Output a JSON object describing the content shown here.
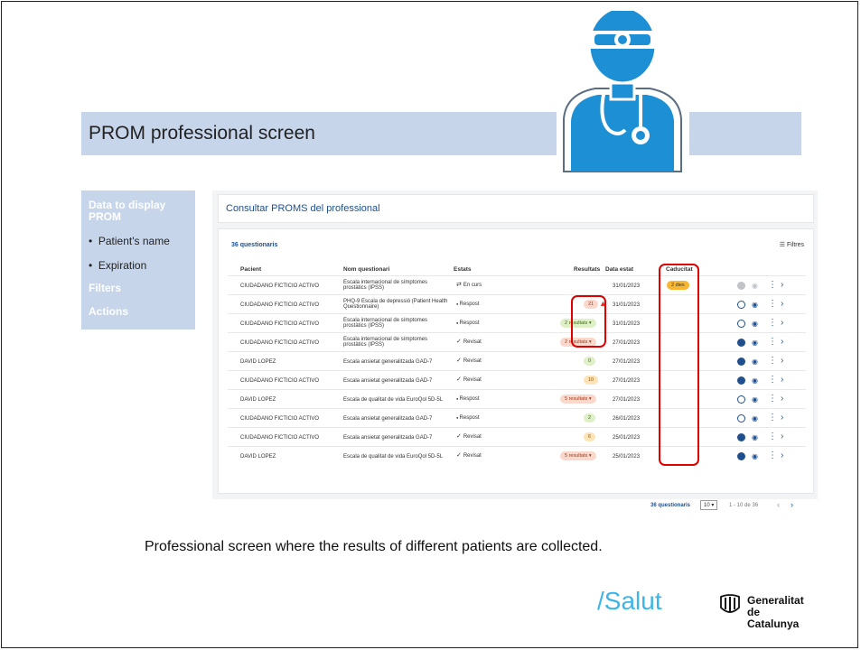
{
  "slide": {
    "title": "PROM professional screen",
    "caption": "Professional screen where the results of different patients are collected.",
    "sidebar": {
      "heading1": "Data to display PROM",
      "items": [
        "Patient's name",
        "Expiration"
      ],
      "heading2": "Filters",
      "heading3": "Actions"
    },
    "footer": {
      "salut": "/Salut",
      "gencat_line1": "Generalitat",
      "gencat_line2": "de Catalunya"
    }
  },
  "app": {
    "page_title": "Consultar PROMS del professional",
    "count_label": "36 questionaris",
    "filters_label": "Filtres",
    "columns": [
      "Pacient",
      "Nom questionari",
      "Estats",
      "Resultats",
      "Data estat",
      "Caducitat"
    ],
    "rows": [
      {
        "patient": "CIUDADANO FICTICIO ACTIVO",
        "questionnaire": "Escala internacional de símptomes prostàtics (IPSS)",
        "state": "En curs",
        "state_icon": "arrows",
        "result": "",
        "result_style": "",
        "alert": false,
        "date": "31/01/2023",
        "expiry": "2 dies",
        "check": "grey"
      },
      {
        "patient": "CIUDADANO FICTICIO ACTIVO",
        "questionnaire": "PHQ-9 Escala de depressió (Patient Health Questionnaire)",
        "state": "Respost",
        "state_icon": "dot",
        "result": "21",
        "result_style": "orange",
        "alert": true,
        "date": "31/01/2023",
        "expiry": "",
        "check": "outline"
      },
      {
        "patient": "CIUDADANO FICTICIO ACTIVO",
        "questionnaire": "Escala internacional de símptomes prostàtics (IPSS)",
        "state": "Respost",
        "state_icon": "dot",
        "result": "2 resultats",
        "result_style": "green",
        "alert": false,
        "date": "31/01/2023",
        "expiry": "",
        "check": "outline"
      },
      {
        "patient": "CIUDADANO FICTICIO ACTIVO",
        "questionnaire": "Escala internacional de símptomes prostàtics (IPSS)",
        "state": "Revisat",
        "state_icon": "check",
        "result": "2 resultats",
        "result_style": "orange",
        "alert": false,
        "date": "27/01/2023",
        "expiry": "",
        "check": "filled"
      },
      {
        "patient": "DAVID LOPEZ",
        "questionnaire": "Escala ansietat generalitzada GAD-7",
        "state": "Revisat",
        "state_icon": "check",
        "result": "0",
        "result_style": "green",
        "alert": false,
        "date": "27/01/2023",
        "expiry": "",
        "check": "filled"
      },
      {
        "patient": "CIUDADANO FICTICIO ACTIVO",
        "questionnaire": "Escala ansietat generalitzada GAD-7",
        "state": "Revisat",
        "state_icon": "check",
        "result": "10",
        "result_style": "amber",
        "alert": false,
        "date": "27/01/2023",
        "expiry": "",
        "check": "filled"
      },
      {
        "patient": "DAVID LOPEZ",
        "questionnaire": "Escala de qualitat de vida EuroQol 5D-5L",
        "state": "Respost",
        "state_icon": "dot",
        "result": "5 resultats",
        "result_style": "orange",
        "alert": false,
        "date": "27/01/2023",
        "expiry": "",
        "check": "outline"
      },
      {
        "patient": "CIUDADANO FICTICIO ACTIVO",
        "questionnaire": "Escala ansietat generalitzada GAD-7",
        "state": "Respost",
        "state_icon": "dot",
        "result": "2",
        "result_style": "green",
        "alert": false,
        "date": "26/01/2023",
        "expiry": "",
        "check": "outline"
      },
      {
        "patient": "CIUDADANO FICTICIO ACTIVO",
        "questionnaire": "Escala ansietat generalitzada GAD-7",
        "state": "Revisat",
        "state_icon": "check",
        "result": "6",
        "result_style": "amber",
        "alert": false,
        "date": "25/01/2023",
        "expiry": "",
        "check": "filled"
      },
      {
        "patient": "DAVID LOPEZ",
        "questionnaire": "Escala de qualitat de vida EuroQol 5D-5L",
        "state": "Revisat",
        "state_icon": "check",
        "result": "5 resultats",
        "result_style": "orange",
        "alert": false,
        "date": "25/01/2023",
        "expiry": "",
        "check": "filled"
      }
    ],
    "pager": {
      "total": "36 questionaris",
      "per_page": "10",
      "range": "1 - 10 de 36"
    }
  },
  "colors": {
    "accent": "#1f4f8c",
    "band": "#c6d5ea",
    "highlight": "#e00000",
    "salut": "#3cb6e8"
  }
}
